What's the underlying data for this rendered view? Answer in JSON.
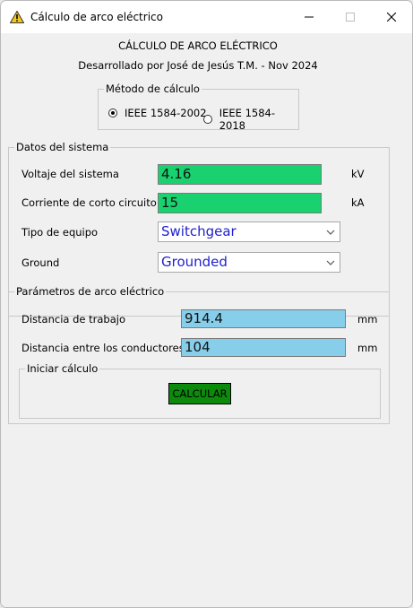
{
  "window": {
    "title": "Cálculo de arco eléctrico",
    "icon": "warning-triangle-icon",
    "controls": {
      "minimize": "minimize-icon",
      "maximize": "maximize-icon",
      "close": "close-icon"
    }
  },
  "header": {
    "title": "CÁLCULO DE ARCO ELÉCTRICO",
    "subtitle": "Desarrollado por José de Jesús T.M. - Nov 2024"
  },
  "method": {
    "legend": "Método de cálculo",
    "options": [
      {
        "label": "IEEE 1584-2002",
        "checked": true
      },
      {
        "label": "IEEE 1584-2018",
        "checked": false
      }
    ]
  },
  "system": {
    "legend": "Datos del sistema",
    "voltage": {
      "label": "Voltaje del sistema",
      "value": "4.16",
      "unit": "kV"
    },
    "current": {
      "label": "Corriente de corto circuito",
      "value": "15",
      "unit": "kA"
    },
    "equipment": {
      "label": "Tipo de equipo",
      "selected": "Switchgear"
    },
    "ground": {
      "label": "Ground",
      "selected": "Grounded"
    }
  },
  "arc": {
    "legend": "Parámetros de arco eléctrico",
    "working_distance": {
      "label": "Distancia de trabajo",
      "value": "914.4",
      "unit": "mm"
    },
    "conductor_gap": {
      "label": "Distancia entre los conductores",
      "value": "104",
      "unit": "mm"
    }
  },
  "calc": {
    "legend": "Iniciar cálculo",
    "button_label": "CALCULAR"
  },
  "colors": {
    "entry_green": "#19d16e",
    "entry_blue": "#87ceeb",
    "combo_text": "#1f1fcc",
    "button_green": "#0c8a0c"
  }
}
